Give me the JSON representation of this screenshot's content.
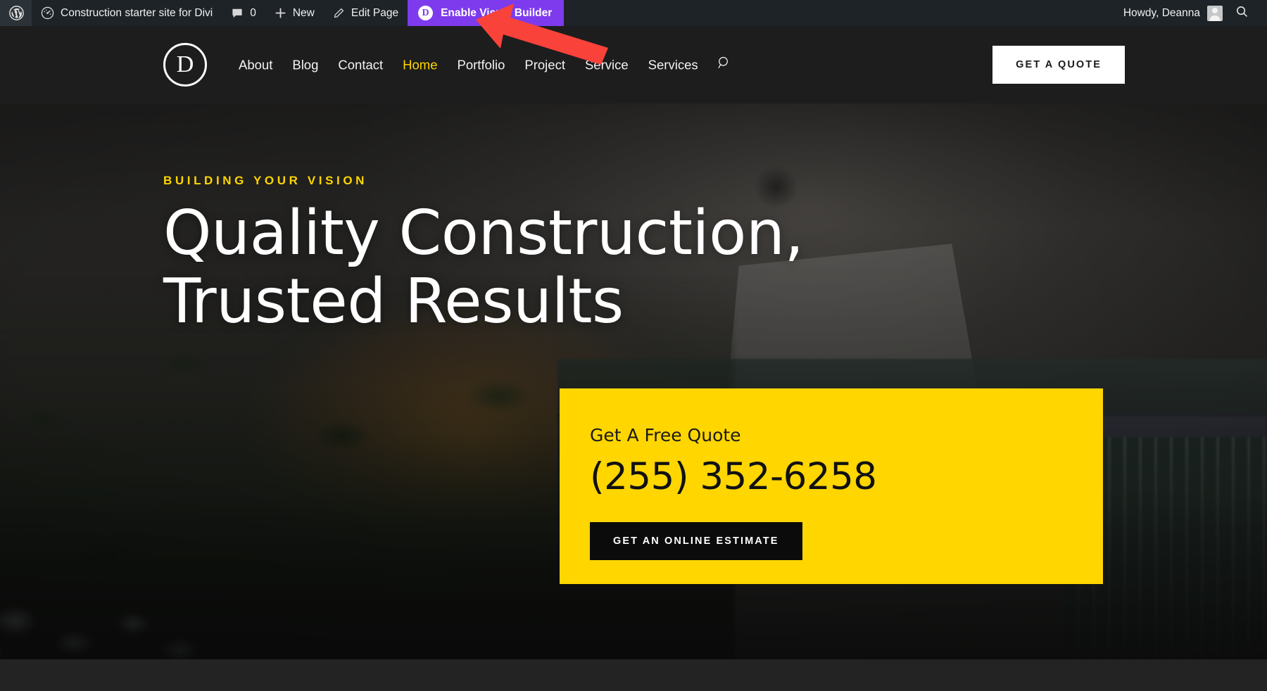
{
  "adminbar": {
    "wp_logo_icon": "wordpress-icon",
    "site_icon": "dashboard-speedometer-icon",
    "site_name": "Construction starter site for Divi",
    "comments_icon": "comment-bubble-icon",
    "comments_count": "0",
    "new_icon": "plus-icon",
    "new_label": "New",
    "edit_icon": "pencil-icon",
    "edit_label": "Edit Page",
    "visual_builder": {
      "icon_letter": "D",
      "label": "Enable Visual Builder",
      "bg_color": "#7e3bed"
    },
    "howdy_label": "Howdy, Deanna",
    "avatar_icon": "avatar-icon",
    "search_icon": "search-icon",
    "bg_color": "#1d2327"
  },
  "header": {
    "logo_letter": "D",
    "nav": [
      {
        "label": "About",
        "active": false
      },
      {
        "label": "Blog",
        "active": false
      },
      {
        "label": "Contact",
        "active": false
      },
      {
        "label": "Home",
        "active": true
      },
      {
        "label": "Portfolio",
        "active": false
      },
      {
        "label": "Project",
        "active": false
      },
      {
        "label": "Service",
        "active": false
      },
      {
        "label": "Services",
        "active": false
      }
    ],
    "search_icon": "search-icon",
    "cta_label": "GET A QUOTE",
    "active_color": "#ffd600",
    "bg_color": "#1d1d1d"
  },
  "hero": {
    "eyebrow": "BUILDING YOUR VISION",
    "headline_line1": "Quality Construction,",
    "headline_line2": "Trusted Results",
    "accent_color": "#ffd600",
    "quote_card": {
      "title": "Get A Free Quote",
      "phone": "(255) 352-6258",
      "button_label": "GET AN ONLINE ESTIMATE",
      "bg_color": "#ffd600",
      "button_bg": "#0b0b0b"
    }
  },
  "annotation": {
    "arrow_icon": "red-arrow-pointing-left",
    "color": "#f9423a",
    "points_to": "Enable Visual Builder"
  }
}
